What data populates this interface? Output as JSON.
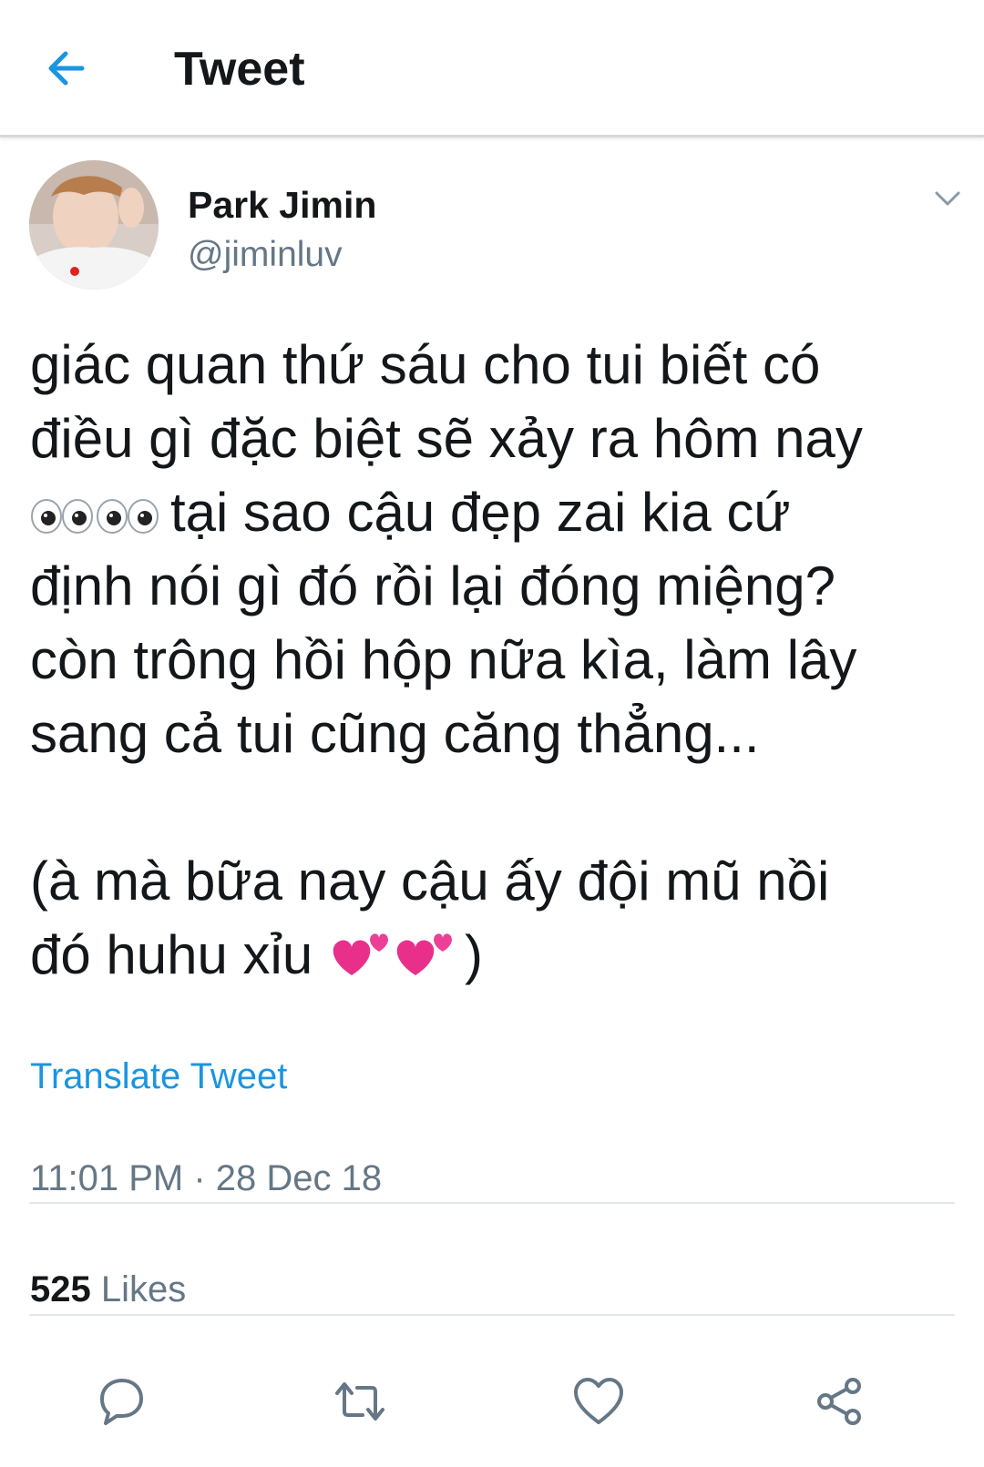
{
  "header": {
    "title": "Tweet",
    "back_icon": "arrow-left-icon"
  },
  "author": {
    "name": "Park Jimin",
    "handle": "@jiminluv"
  },
  "tweet": {
    "line1": "giác quan thứ sáu cho tui biết có",
    "line2": "điều gì đặc biệt sẽ xảy ra hôm nay",
    "line3_emoji": "👀👀",
    "line3_text": "tại sao cậu đẹp zai kia cứ",
    "line4": "định nói gì đó rồi lại đóng miệng?",
    "line5": "còn trông hồi hộp nữa kìa, làm lây",
    "line6": "sang cả tui cũng căng thẳng...",
    "line7": "(à mà bữa nay cậu ấy đội mũ nồi",
    "line8_text": "đó huhu xỉu ",
    "line8_emoji": "💕💕",
    "line8_end": ")"
  },
  "translate_label": "Translate Tweet",
  "timestamp": "11:01 PM · 28 Dec 18",
  "likes": {
    "count": "525",
    "label": " Likes"
  },
  "actions": [
    "reply-icon",
    "retweet-icon",
    "like-icon",
    "share-icon"
  ],
  "colors": {
    "accent": "#1b95e0",
    "secondary_text": "#657786",
    "primary_text": "#14171a"
  }
}
